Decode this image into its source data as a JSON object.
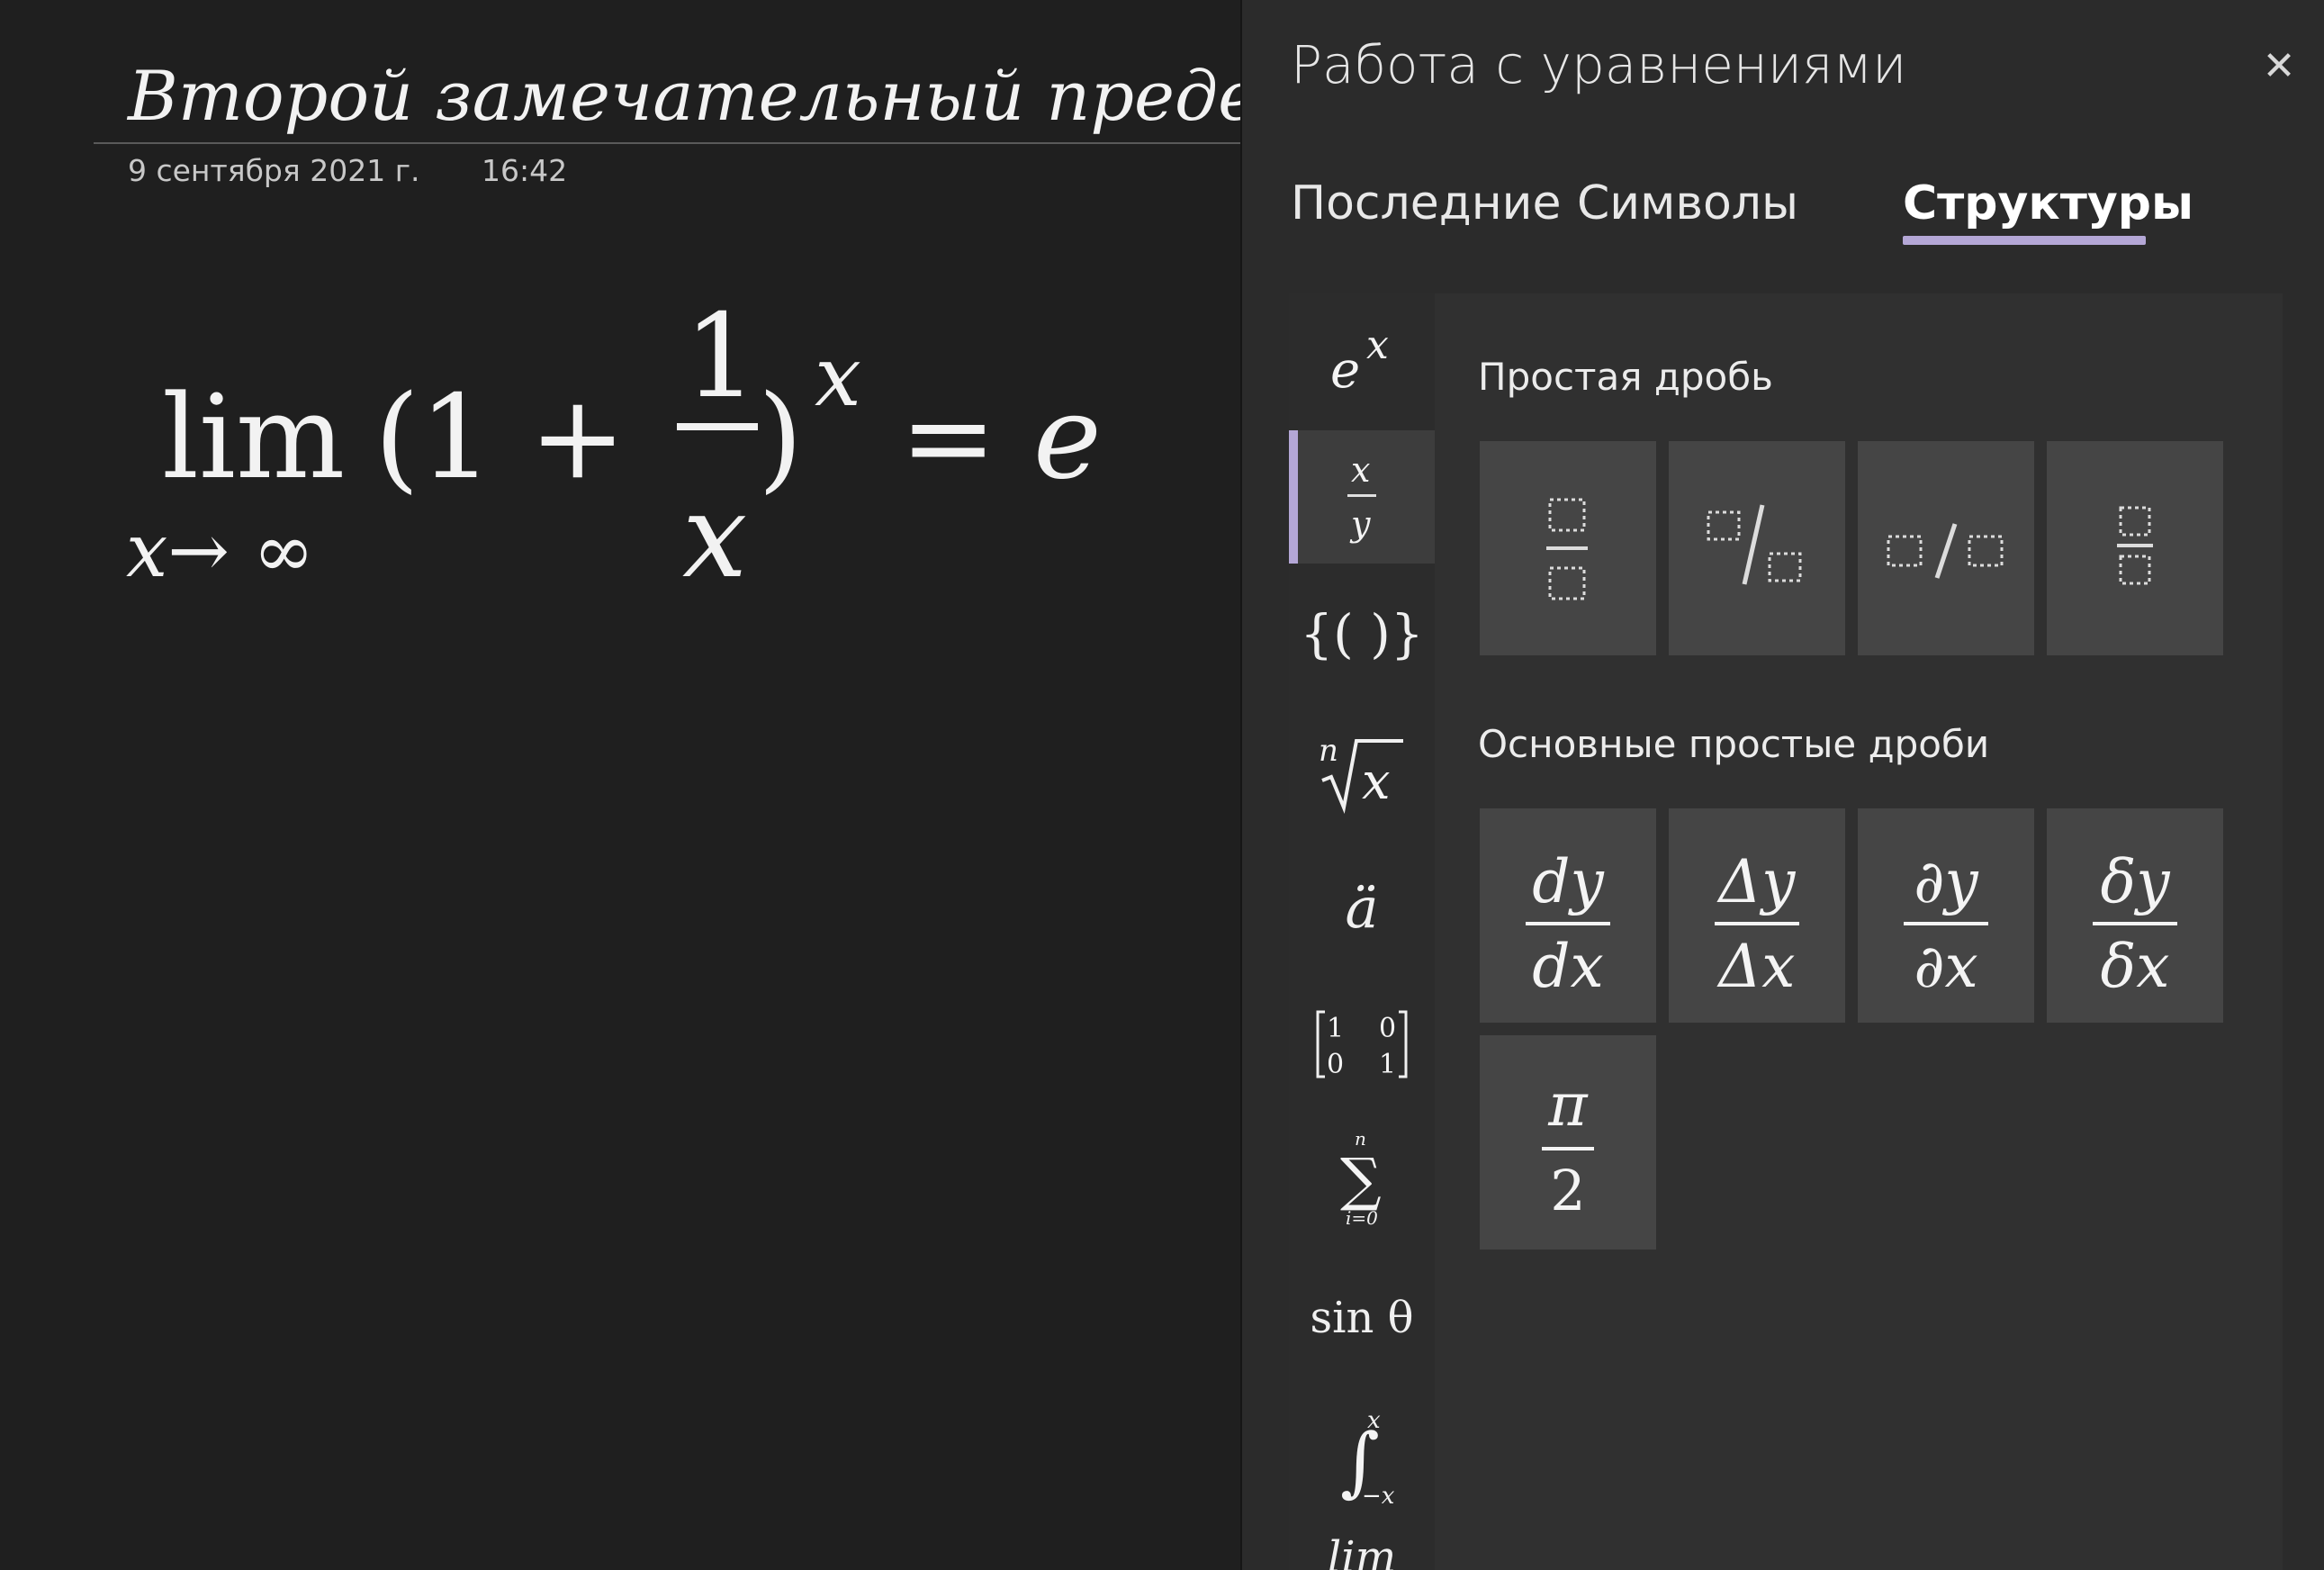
{
  "note": {
    "title": "Второй замечательный предел",
    "date": "9 сентября 2021 г.",
    "time": "16:42",
    "equation": {
      "operator": "lim",
      "subscript": "x→ ∞",
      "open": "(1 +",
      "numerator": "1",
      "denominator": "x",
      "close": ")",
      "exponent": "x",
      "rhs": "= e"
    }
  },
  "pane": {
    "title": "Работа с уравнениями",
    "close_glyph": "✕",
    "tabs": [
      {
        "label": "Последние",
        "active": false
      },
      {
        "label": "Символы",
        "active": false
      },
      {
        "label": "Структуры",
        "active": true
      }
    ],
    "categories": [
      {
        "name": "script",
        "base": "e",
        "sup": "x"
      },
      {
        "name": "fraction",
        "top": "x",
        "bottom": "y",
        "active": true
      },
      {
        "name": "bracket",
        "glyph": "{( )}"
      },
      {
        "name": "radical",
        "index": "n",
        "radicand": "x"
      },
      {
        "name": "accent",
        "glyph": "ä"
      },
      {
        "name": "matrix",
        "cells": [
          "1",
          "0",
          "0",
          "1"
        ]
      },
      {
        "name": "large-operator",
        "top": "n",
        "symbol": "∑",
        "bottom": "i=0"
      },
      {
        "name": "function",
        "glyph": "sin θ"
      },
      {
        "name": "integral",
        "upper": "x",
        "lower": "−x"
      },
      {
        "name": "limit-log",
        "glyph": "lim"
      }
    ],
    "sections": [
      {
        "title": "Простая дробь",
        "items": [
          "stacked-fraction",
          "skewed-fraction",
          "linear-fraction",
          "small-fraction"
        ]
      },
      {
        "title": "Основные простые дроби",
        "items": [
          {
            "num": "dy",
            "den": "dx"
          },
          {
            "num": "Δy",
            "den": "Δx"
          },
          {
            "num": "∂y",
            "den": "∂x"
          },
          {
            "num": "δy",
            "den": "δx"
          },
          {
            "num": "π",
            "den": "2"
          }
        ]
      }
    ],
    "accent_color": "#b4a7d6"
  }
}
